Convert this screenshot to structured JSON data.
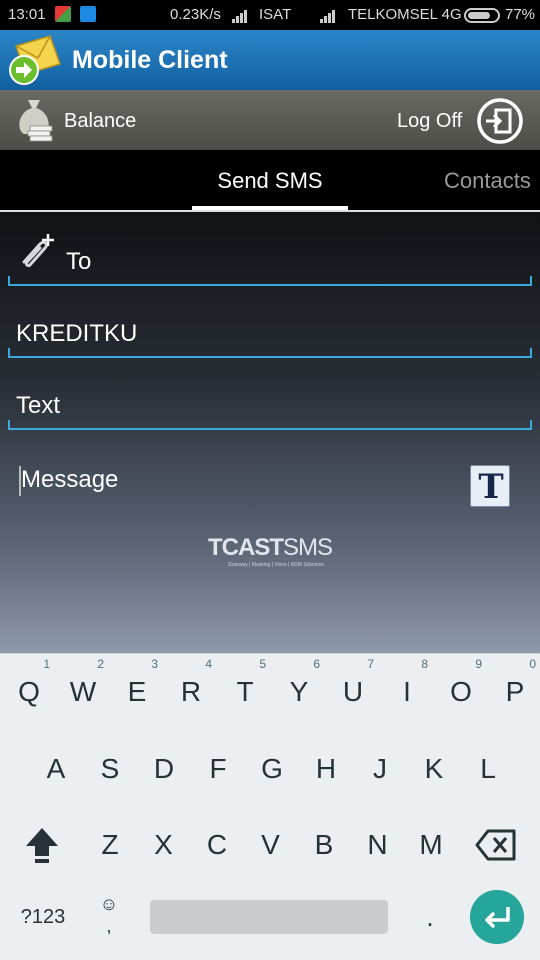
{
  "status_bar": {
    "time": "13:01",
    "network_speed": "0.23K/s",
    "operator1": "ISAT",
    "operator2": "TELKOMSEL 4G",
    "battery_percent": "77%",
    "battery_level": 0.77
  },
  "app": {
    "title": "Mobile Client",
    "balance_label": "Balance",
    "logoff_label": "Log Off"
  },
  "tabs": {
    "send_sms": "Send SMS",
    "contacts": "Contacts"
  },
  "form": {
    "to_placeholder": "To",
    "sender_value": "KREDITKU",
    "type_value": "Text",
    "message_placeholder": "Message"
  },
  "branding": {
    "name_main": "TCAST",
    "name_suffix": "SMS",
    "tagline": "Gateway | Masking | Voice | M2M Solutions"
  },
  "keyboard": {
    "row1": [
      "Q",
      "W",
      "E",
      "R",
      "T",
      "Y",
      "U",
      "I",
      "O",
      "P"
    ],
    "row1_hints": [
      "1",
      "2",
      "3",
      "4",
      "5",
      "6",
      "7",
      "8",
      "9",
      "0"
    ],
    "row2": [
      "A",
      "S",
      "D",
      "F",
      "G",
      "H",
      "J",
      "K",
      "L"
    ],
    "row3": [
      "Z",
      "X",
      "C",
      "V",
      "B",
      "N",
      "M"
    ],
    "symbols_label": "?123",
    "emoji_label": "☺",
    "comma_label": ",",
    "period_label": "."
  },
  "colors": {
    "app_bar": "#1e73b5",
    "field_underline": "#3aa9dd",
    "enter_key": "#26a69a",
    "keyboard_bg": "#eceff1"
  }
}
